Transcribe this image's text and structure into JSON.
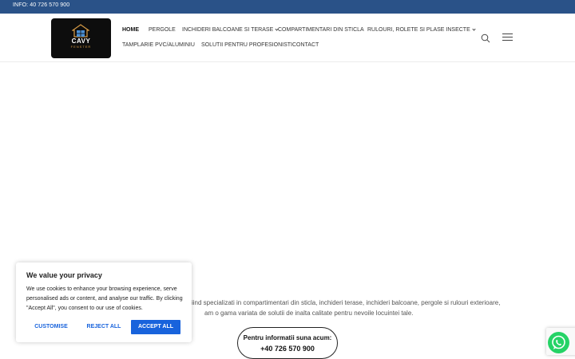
{
  "topbar": {
    "info": "INFO: 40 726 570 900"
  },
  "logo": {
    "title": "CAVY",
    "subtitle": "FENSTER"
  },
  "nav": {
    "items": [
      {
        "label": "HOME"
      },
      {
        "label": "PERGOLE"
      },
      {
        "label": "INCHIDERI BALCOANE SI TERASE"
      },
      {
        "label": "COMPARTIMENTARI DIN STICLA"
      },
      {
        "label": "RULOURI, ROLETE SI PLASE INSECTE"
      },
      {
        "label": "TAMPLARIE PVC/ALUMINIU"
      },
      {
        "label": "SOLUTII PENTRU PROFESIONISTI"
      },
      {
        "label": "CONTACT"
      }
    ]
  },
  "hero": {
    "line1": "ta! Fiind specializati in compartimentari din sticla, inchideri terase, inchideri balcoane, pergole si rulouri exterioare,",
    "line2": "am o gama variata de solutii de inalta calitate pentru nevoile locuintei tale."
  },
  "call_button": {
    "line1": "Pentru informatii suna acum:",
    "line2": "+40 726 570 900"
  },
  "cookie": {
    "title": "We value your privacy",
    "body": "We use cookies to enhance your browsing experience, serve personalised ads or content, and analyse our traffic. By clicking \"Accept All\", you consent to our use of cookies.",
    "customise": "CUSTOMISE",
    "reject": "REJECT ALL",
    "accept": "ACCEPT ALL"
  },
  "colors": {
    "topbar": "#2a5288",
    "accent": "#1863dc",
    "whatsapp": "#25d366"
  },
  "icons": {
    "search": "search-icon",
    "menu": "hamburger-menu-icon",
    "whatsapp": "whatsapp-icon"
  }
}
